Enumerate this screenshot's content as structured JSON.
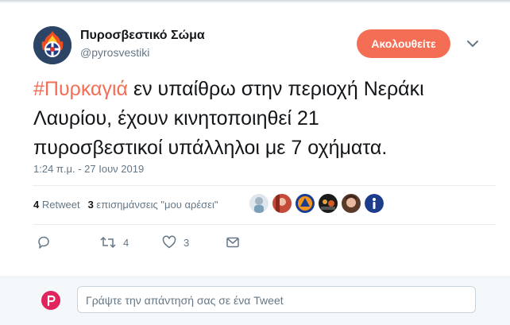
{
  "author": {
    "display_name": "Πυροσβεστικό Σώμα",
    "handle": "@pyrosvestiki",
    "follow_label": "Ακολουθείτε"
  },
  "tweet": {
    "hashtag": "#Πυρκαγιά",
    "text_line1_rest": " εν υπαίθρω στην περιοχή Νεράκι",
    "text_line2": "Λαυρίου, έχουν κινητοποιηθεί 21",
    "text_line3": "πυροσβεστικοί υπάλληλοι με 7 οχήματα.",
    "timestamp": "1:24 π.μ. - 27 Ιουν 2019"
  },
  "stats": {
    "retweet_count": "4",
    "retweet_label": "Retweet",
    "like_count": "3",
    "like_label": "επισημάνσεις \"μου αρέσει\""
  },
  "actions": {
    "retweet_count": "4",
    "like_count": "3"
  },
  "reply": {
    "placeholder": "Γράψτε την απάντησή σας σε ένα Tweet"
  },
  "colors": {
    "accent": "#f36e55",
    "secondary_text": "#657786"
  },
  "icons": [
    "fire-service-logo-icon",
    "chevron-down-icon",
    "reply-icon",
    "retweet-icon",
    "heart-icon",
    "message-icon",
    "info-icon"
  ]
}
